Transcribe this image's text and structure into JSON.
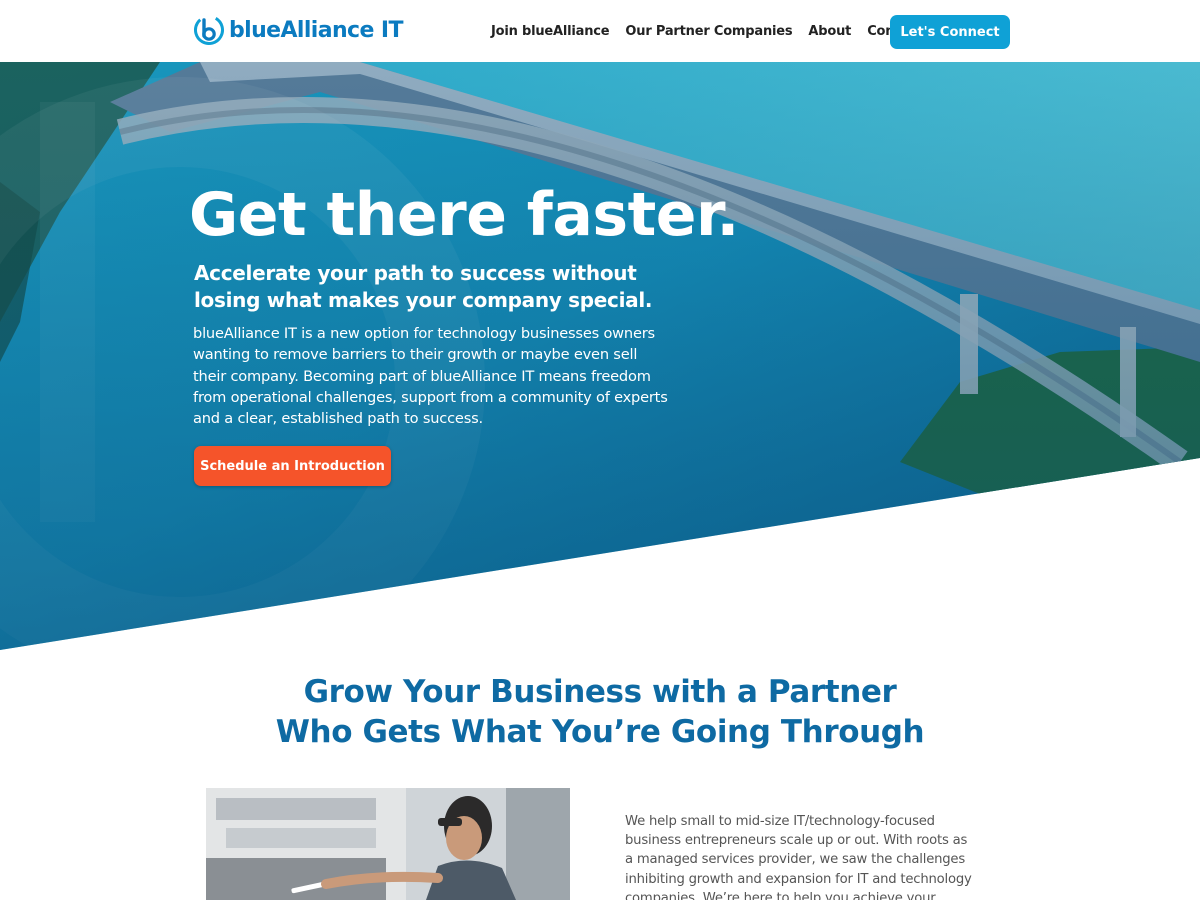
{
  "header": {
    "logo": {
      "brand": "blueAlliance",
      "suffix": "IT"
    },
    "nav": [
      {
        "label": "Join blueAlliance"
      },
      {
        "label": "Our Partner Companies"
      },
      {
        "label": "About"
      },
      {
        "label": "Contact"
      }
    ],
    "cta_label": "Let's Connect"
  },
  "hero": {
    "title": "Get there faster.",
    "subtitle": "Accelerate your path to success without losing what makes your company special.",
    "body": "blueAlliance IT is a new option for technology businesses owners wanting to remove barriers to their growth or maybe even sell their company. Becoming part of blueAlliance IT means freedom from operational challenges, support from a community of experts and a clear, established path to success.",
    "button_label": "Schedule an Introduction"
  },
  "intro": {
    "title_line1": "Grow Your Business with a Partner",
    "title_line2": "Who Gets What You’re Going Through",
    "body": "We help small to mid-size IT/technology-focused business entrepreneurs scale up or out. With roots as a managed services provider, we saw the challenges inhibiting growth and expansion for IT and technology companies. We’re here to help you achieve your"
  },
  "colors": {
    "brand_blue": "#0b7bc0",
    "connect_button": "#0fa1d6",
    "schedule_button": "#f5542a",
    "section_title": "#0e6aa3"
  }
}
